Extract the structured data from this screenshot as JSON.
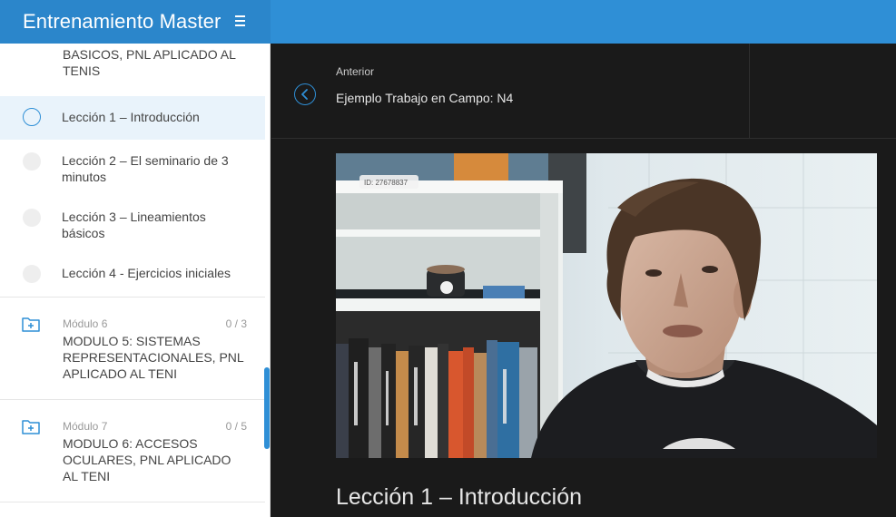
{
  "app": {
    "title": "Entrenamiento Master",
    "accent_color": "#2f8fd6"
  },
  "sidebar": {
    "current_module_title": "BASICOS, PNL APLICADO AL TENIS",
    "lessons": [
      {
        "label": "Lección 1 – Introducción",
        "active": true
      },
      {
        "label": "Lección 2 – El seminario de 3 minutos",
        "active": false
      },
      {
        "label": "Lección 3 – Lineamientos básicos",
        "active": false
      },
      {
        "label": "Lección 4 - Ejercicios iniciales",
        "active": false
      }
    ],
    "modules": [
      {
        "number": "Módulo 6",
        "progress": "0 / 3",
        "name": "MODULO 5: SISTEMAS REPRESENTACIONALES, PNL APLICADO AL TENI",
        "icon": "folder-plus-icon"
      },
      {
        "number": "Módulo 7",
        "progress": "0 / 5",
        "name": "MODULO 6: ACCESOS OCULARES, PNL APLICADO AL TENI",
        "icon": "folder-plus-icon"
      }
    ]
  },
  "navigation": {
    "previous_caption": "Anterior",
    "previous_title": "Ejemplo Trabajo en Campo: N4",
    "icon": "chevron-left-icon"
  },
  "video": {
    "overlay_id": "ID: 27678837"
  },
  "lesson": {
    "title": "Lección 1 – Introducción"
  }
}
